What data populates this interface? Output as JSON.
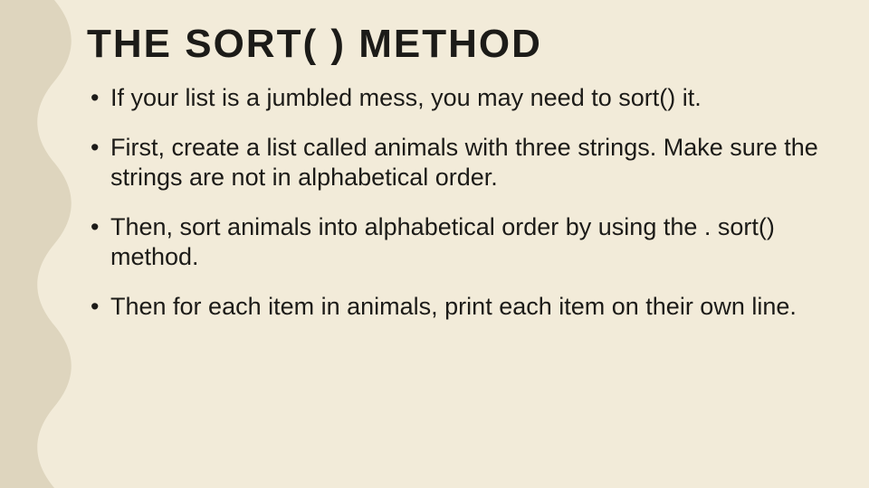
{
  "slide": {
    "title": "THE SORT( ) METHOD",
    "bullets": [
      "If your list is a jumbled mess, you may need to sort() it.",
      "First, create a list called animals with three strings. Make sure the strings are not in alphabetical order.",
      "Then, sort animals into alphabetical order by using the . sort() method.",
      "Then for each item in animals, print each item on their own line."
    ],
    "theme": {
      "background": "#f2ebd9",
      "wave_color": "#ded5be",
      "text_color": "#1c1b18"
    }
  }
}
